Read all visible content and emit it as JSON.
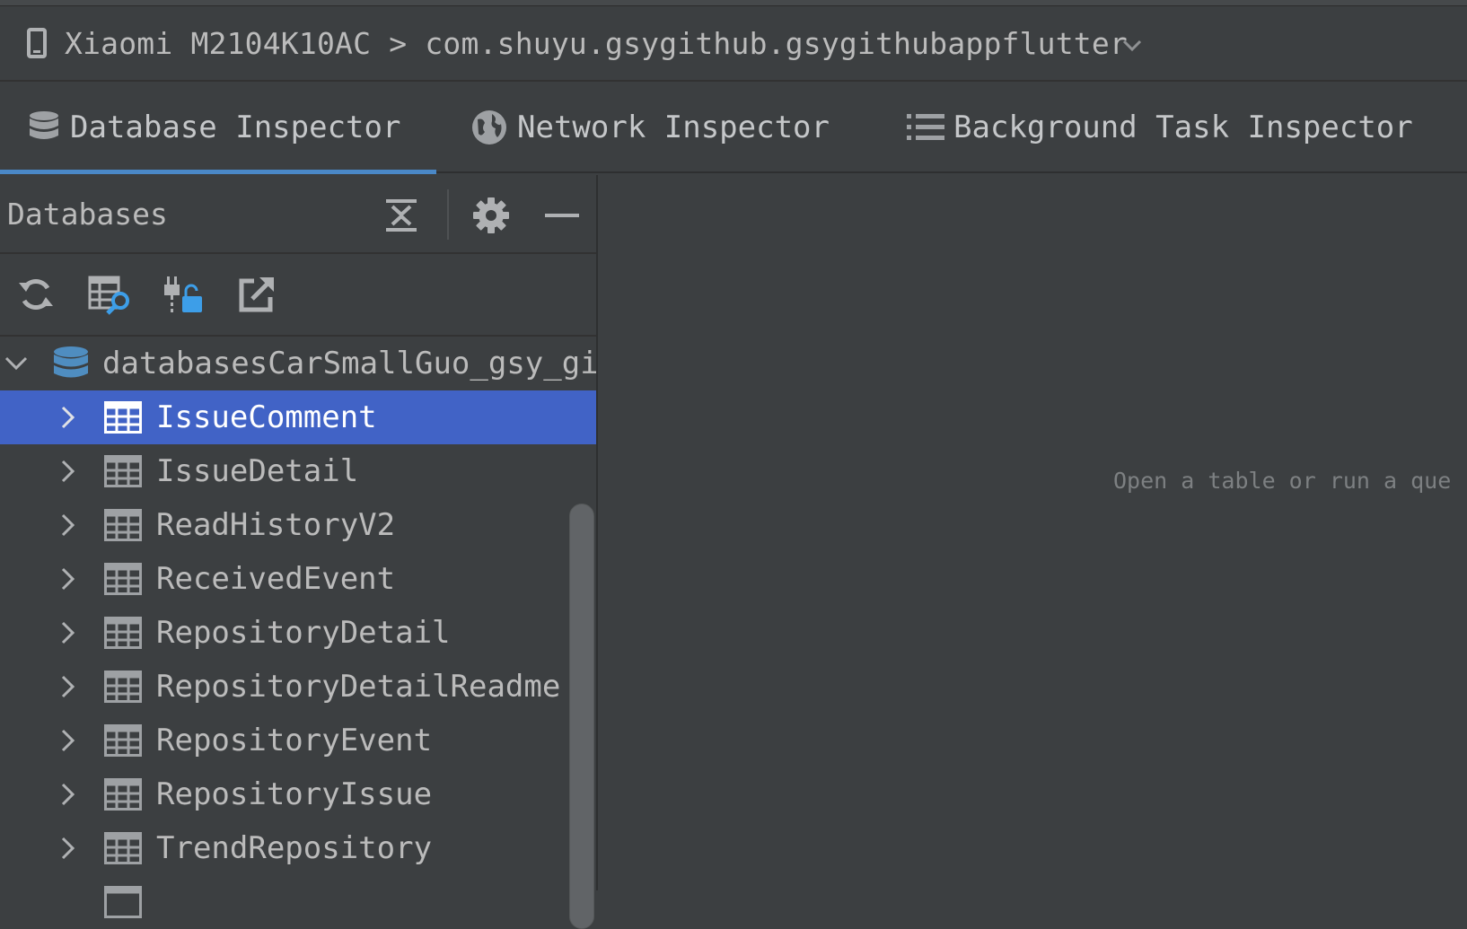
{
  "device": {
    "label": "Xiaomi M2104K10AC > com.shuyu.gsygithub.gsygithubappflutter",
    "dropdown_icon": "chevron-down-icon"
  },
  "tabs": [
    {
      "label": "Database Inspector",
      "icon": "database-icon",
      "active": true
    },
    {
      "label": "Network Inspector",
      "icon": "globe-icon",
      "active": false
    },
    {
      "label": "Background Task Inspector",
      "icon": "list-icon",
      "active": false
    }
  ],
  "databases_panel": {
    "title": "Databases",
    "header_icons": [
      "collapse-all-icon",
      "gear-icon",
      "minimize-icon"
    ],
    "toolbar_icons": [
      "refresh-icon",
      "run-query-icon",
      "keep-connections-icon",
      "export-icon"
    ]
  },
  "tree": {
    "database": "databasesCarSmallGuo_gsy_gi",
    "tables": [
      {
        "name": "IssueComment",
        "selected": true
      },
      {
        "name": "IssueDetail",
        "selected": false
      },
      {
        "name": "ReadHistoryV2",
        "selected": false
      },
      {
        "name": "ReceivedEvent",
        "selected": false
      },
      {
        "name": "RepositoryDetail",
        "selected": false
      },
      {
        "name": "RepositoryDetailReadme",
        "selected": false
      },
      {
        "name": "RepositoryEvent",
        "selected": false
      },
      {
        "name": "RepositoryIssue",
        "selected": false
      },
      {
        "name": "TrendRepository",
        "selected": false
      }
    ]
  },
  "main": {
    "empty_message": "Open a table or run a que"
  },
  "colors": {
    "selection": "#4163c6",
    "accent": "#4a88c7",
    "background": "#3c3f41"
  }
}
